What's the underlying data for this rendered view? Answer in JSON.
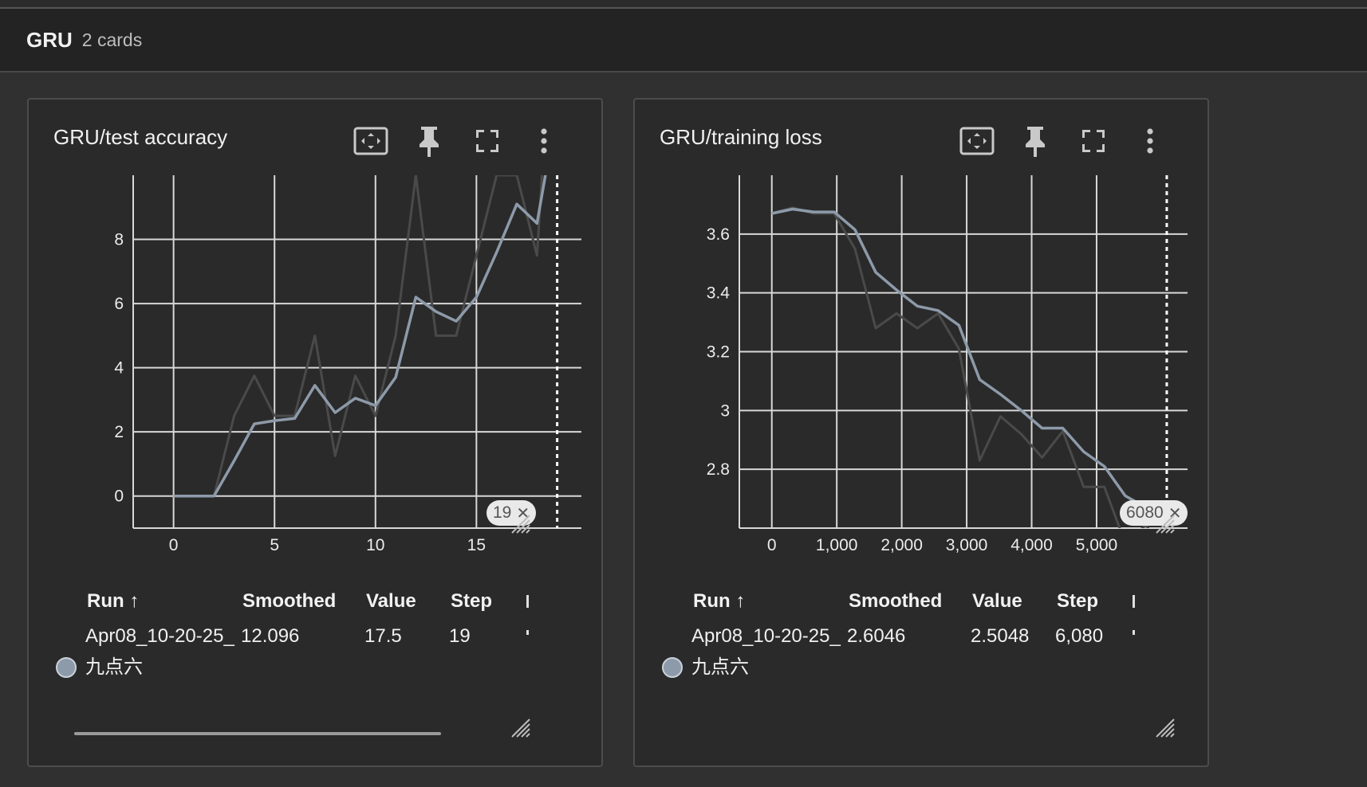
{
  "group": {
    "title": "GRU",
    "count_label": "2 cards"
  },
  "table_headers": {
    "run": "Run ↑",
    "smoothed": "Smoothed",
    "value": "Value",
    "step": "Step"
  },
  "icons": [
    "fit-domain-icon",
    "pin-icon",
    "fullscreen-icon",
    "more-vert-icon",
    "sort-up-icon",
    "resize-handle-icon"
  ],
  "colors": {
    "background": "#303030",
    "card": "#2a2a2a",
    "smoothed_line": "#8d9aa9",
    "raw_line": "#4a4a4a",
    "run_dot": "#8d9aa9"
  },
  "cards": [
    {
      "title": "GRU/test accuracy",
      "step_chip": "19",
      "row": {
        "run_line1": "Apr08_10-20-25_",
        "run_line2": "九点六",
        "smoothed": "12.096",
        "value": "17.5",
        "step": "19"
      },
      "chart_data": {
        "type": "line",
        "title": "GRU/test accuracy",
        "x_ticks": [
          "0",
          "5",
          "10",
          "15"
        ],
        "y_ticks": [
          "0",
          "2",
          "4",
          "6",
          "8"
        ],
        "xlim": [
          -2,
          20.2
        ],
        "ylim": [
          -1,
          10
        ],
        "cursor_step": 19,
        "grid": true,
        "series": [
          {
            "role": "raw",
            "x": [
              0,
              1,
              2,
              3,
              4,
              5,
              6,
              7,
              8,
              9,
              10,
              11,
              12,
              13,
              14,
              15,
              16,
              17,
              18,
              19
            ],
            "values": [
              0,
              0,
              0,
              2.5,
              3.75,
              2.5,
              2.5,
              5,
              1.25,
              3.75,
              2.5,
              5,
              10,
              5,
              5,
              7.5,
              10,
              10,
              7.5,
              17.5
            ]
          },
          {
            "role": "smoothed",
            "x": [
              0,
              1,
              2,
              3,
              4,
              5,
              6,
              7,
              8,
              9,
              10,
              11,
              12,
              13,
              14,
              15,
              16,
              17,
              18,
              19
            ],
            "values": [
              0,
              0,
              0,
              1.1,
              2.25,
              2.35,
              2.42,
              3.45,
              2.6,
              3.05,
              2.82,
              3.7,
              6.2,
              5.75,
              5.45,
              6.2,
              7.6,
              9.1,
              8.5,
              12.096
            ]
          }
        ]
      }
    },
    {
      "title": "GRU/training loss",
      "step_chip": "6080",
      "row": {
        "run_line1": "Apr08_10-20-25_",
        "run_line2": "九点六",
        "smoothed": "2.6046",
        "value": "2.5048",
        "step": "6,080"
      },
      "chart_data": {
        "type": "line",
        "title": "GRU/training loss",
        "x_ticks": [
          "0",
          "1,000",
          "2,000",
          "3,000",
          "4,000",
          "5,000"
        ],
        "y_ticks": [
          "2.8",
          "3",
          "3.2",
          "3.4",
          "3.6"
        ],
        "xlim": [
          -500,
          6400
        ],
        "ylim": [
          2.6,
          3.8
        ],
        "cursor_step": 6080,
        "grid": true,
        "series": [
          {
            "role": "raw",
            "x": [
              0,
              320,
              640,
              960,
              1280,
              1600,
              1920,
              2240,
              2560,
              2880,
              3200,
              3520,
              3840,
              4160,
              4480,
              4800,
              5120,
              5440,
              5760,
              6080
            ],
            "values": [
              3.67,
              3.69,
              3.67,
              3.67,
              3.55,
              3.28,
              3.33,
              3.28,
              3.33,
              3.21,
              2.83,
              2.98,
              2.92,
              2.84,
              2.93,
              2.74,
              2.74,
              2.55,
              2.61,
              2.5048
            ]
          },
          {
            "role": "smoothed",
            "x": [
              0,
              320,
              640,
              960,
              1280,
              1600,
              1920,
              2240,
              2560,
              2880,
              3200,
              3520,
              3840,
              4160,
              4480,
              4800,
              5120,
              5440,
              5760,
              6080
            ],
            "values": [
              3.67,
              3.685,
              3.675,
              3.675,
              3.615,
              3.47,
              3.41,
              3.355,
              3.34,
              3.29,
              3.105,
              3.055,
              3.0,
              2.94,
              2.94,
              2.86,
              2.81,
              2.71,
              2.67,
              2.6046
            ]
          }
        ]
      }
    }
  ]
}
